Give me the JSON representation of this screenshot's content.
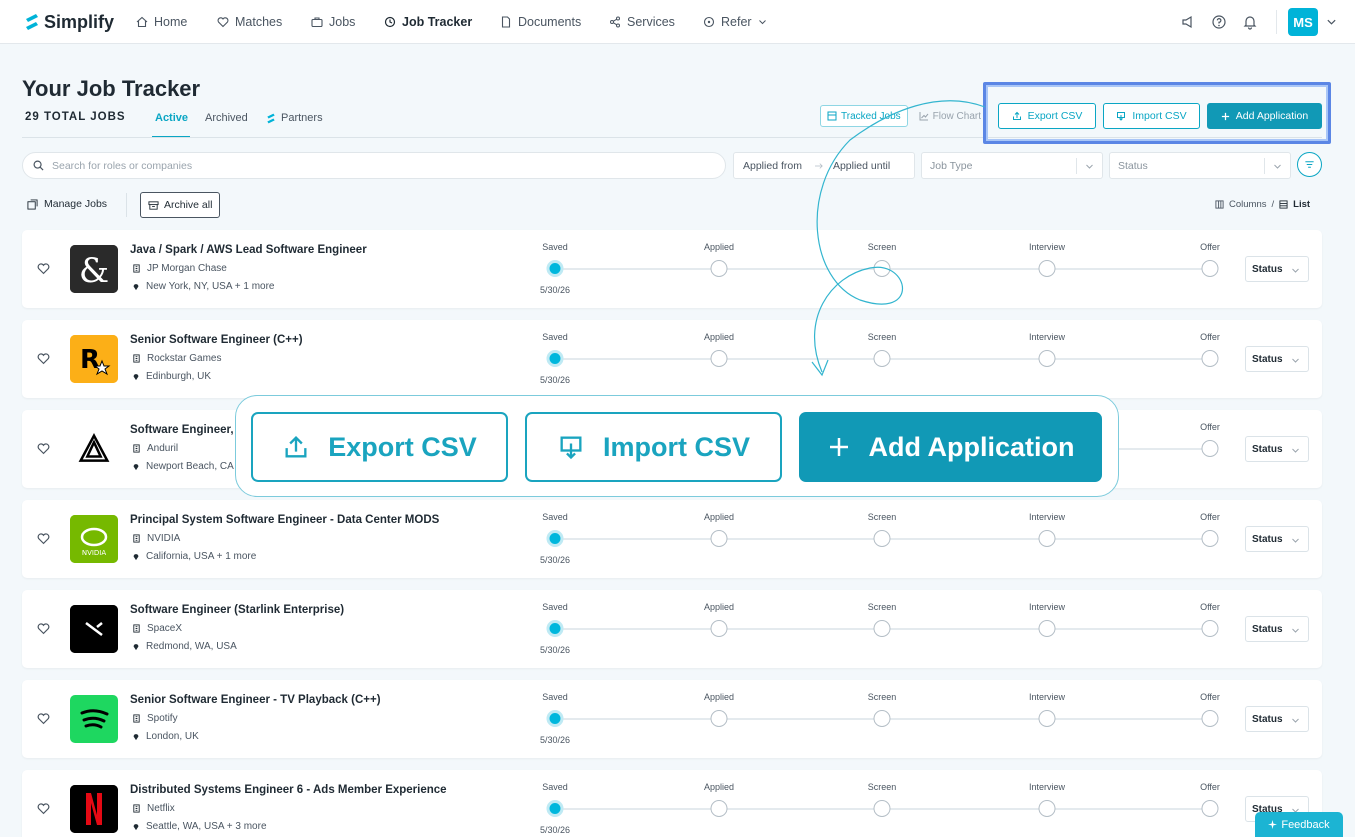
{
  "nav": {
    "brand": "Simplify",
    "items": [
      {
        "label": "Home",
        "active": false
      },
      {
        "label": "Matches",
        "active": false
      },
      {
        "label": "Jobs",
        "active": false
      },
      {
        "label": "Job Tracker",
        "active": true
      },
      {
        "label": "Documents",
        "active": false
      },
      {
        "label": "Services",
        "active": false
      },
      {
        "label": "Refer",
        "active": false
      }
    ],
    "avatar_initials": "MS"
  },
  "header": {
    "title": "Your Job Tracker",
    "total_label": "29 TOTAL JOBS",
    "tabs": [
      "Active",
      "Archived",
      "Partners"
    ],
    "view_toggle": {
      "tracked": "Tracked Jobs",
      "flow": "Flow Chart"
    },
    "export_label": "Export CSV",
    "import_label": "Import CSV",
    "add_label": "Add Application"
  },
  "filters": {
    "search_placeholder": "Search for roles or companies",
    "applied_from": "Applied from",
    "applied_until": "Applied until",
    "job_type": "Job Type",
    "status": "Status"
  },
  "toolbar": {
    "manage_jobs": "Manage Jobs",
    "archive_all": "Archive all",
    "columns": "Columns",
    "separator": "/",
    "list": "List"
  },
  "stages": [
    "Saved",
    "Applied",
    "Screen",
    "Interview",
    "Offer"
  ],
  "jobs": [
    {
      "title": "Java / Spark / AWS Lead Software Engineer",
      "company": "JP Morgan Chase",
      "location": "New York, NY, USA + 1 more",
      "date": "5/30/26",
      "status": "Status",
      "logo": "jpmorgan-logo",
      "logo_color": "#2a2a2a"
    },
    {
      "title": "Senior Software Engineer (C++)",
      "company": "Rockstar Games",
      "location": "Edinburgh, UK",
      "date": "5/30/26",
      "status": "Status",
      "logo": "rockstar-logo",
      "logo_color": "#fcaf17"
    },
    {
      "title": "Software Engineer,",
      "company": "Anduril",
      "location": "Newport Beach, CA",
      "date": "",
      "status": "Status",
      "logo": "anduril-logo",
      "logo_color": "#ffffff"
    },
    {
      "title": "Principal System Software Engineer - Data Center MODS",
      "company": "NVIDIA",
      "location": "California, USA + 1 more",
      "date": "5/30/26",
      "status": "Status",
      "logo": "nvidia-logo",
      "logo_color": "#76b900"
    },
    {
      "title": "Software Engineer (Starlink Enterprise)",
      "company": "SpaceX",
      "location": "Redmond, WA, USA",
      "date": "5/30/26",
      "status": "Status",
      "logo": "spacex-logo",
      "logo_color": "#000000"
    },
    {
      "title": "Senior Software Engineer - TV Playback (C++)",
      "company": "Spotify",
      "location": "London, UK",
      "date": "5/30/26",
      "status": "Status",
      "logo": "spotify-logo",
      "logo_color": "#1ed760"
    },
    {
      "title": "Distributed Systems Engineer 6 - Ads Member Experience",
      "company": "Netflix",
      "location": "Seattle, WA, USA + 3 more",
      "date": "5/30/26",
      "status": "Status",
      "logo": "netflix-logo",
      "logo_color": "#000000"
    }
  ],
  "zoom_callout": {
    "export_label": "Export CSV",
    "import_label": "Import CSV",
    "add_label": "Add Application"
  },
  "feedback_label": "Feedback",
  "colors": {
    "accent": "#0aa6c4",
    "primary": "#1199b6",
    "highlight": "#5b86e5"
  }
}
